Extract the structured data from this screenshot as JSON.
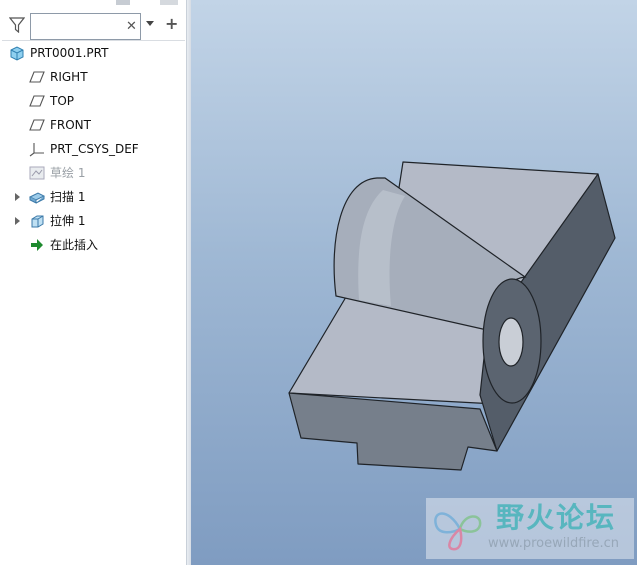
{
  "model_tree": {
    "search": {
      "value": "",
      "placeholder": ""
    },
    "items": [
      {
        "label": "PRT0001.PRT",
        "icon": "part-icon",
        "disabled": false
      },
      {
        "label": "RIGHT",
        "icon": "datum-plane-icon",
        "disabled": false
      },
      {
        "label": "TOP",
        "icon": "datum-plane-icon",
        "disabled": false
      },
      {
        "label": "FRONT",
        "icon": "datum-plane-icon",
        "disabled": false
      },
      {
        "label": "PRT_CSYS_DEF",
        "icon": "csys-icon",
        "disabled": false
      },
      {
        "label": "草绘 1",
        "icon": "sketch-icon",
        "disabled": true
      },
      {
        "label": "扫描 1",
        "icon": "sweep-icon",
        "disabled": false,
        "expandable": true
      },
      {
        "label": "拉伸 1",
        "icon": "extrude-icon",
        "disabled": false,
        "expandable": true
      },
      {
        "label": "在此插入",
        "icon": "insert-here-arrow-icon",
        "disabled": false
      }
    ]
  },
  "watermark": {
    "title": "野火论坛",
    "url": "www.proewildfire.cn"
  },
  "colors": {
    "viewport_top": "#c2d4e7",
    "viewport_bottom": "#7f9cc1",
    "insert_arrow": "#1e8a2e",
    "watermark_text": "#58b6bf"
  }
}
